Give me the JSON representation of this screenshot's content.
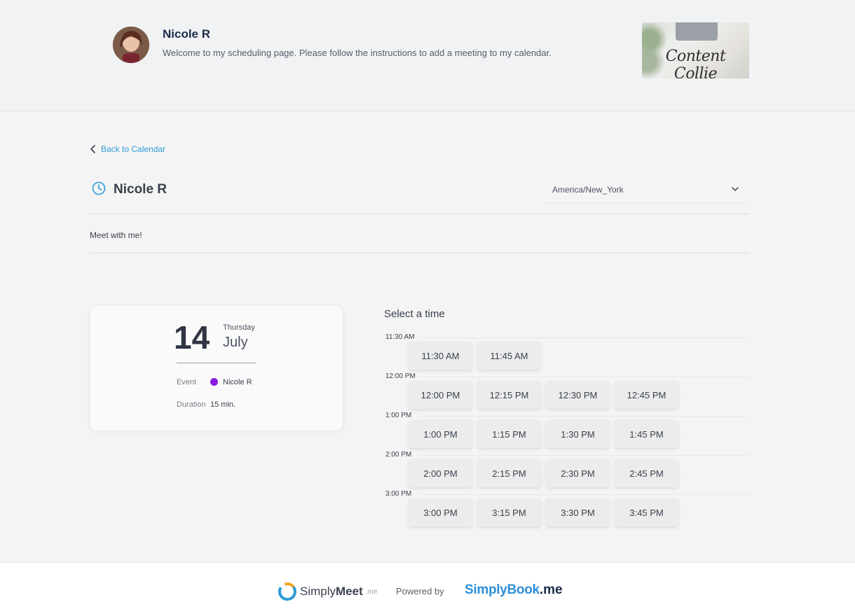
{
  "header": {
    "host_name": "Nicole R",
    "welcome_text": "Welcome to my scheduling page. Please follow the instructions to add a meeting to my calendar.",
    "logo_text": "Content Collie"
  },
  "nav": {
    "back_label": "Back to Calendar"
  },
  "booking": {
    "title": "Nicole R",
    "timezone": "America/New_York",
    "description": "Meet with me!"
  },
  "summary": {
    "day": "14",
    "weekday": "Thursday",
    "month": "July",
    "event_label": "Event",
    "event_value": "Nicole R",
    "duration_label": "Duration",
    "duration_value": "15 min.",
    "event_color": "#8a1be0"
  },
  "times": {
    "heading": "Select a time",
    "groups": [
      {
        "hour": "11:30 AM",
        "slots": [
          "11:30 AM",
          "11:45 AM"
        ]
      },
      {
        "hour": "12:00 PM",
        "slots": [
          "12:00 PM",
          "12:15 PM",
          "12:30 PM",
          "12:45 PM"
        ]
      },
      {
        "hour": "1:00 PM",
        "slots": [
          "1:00 PM",
          "1:15 PM",
          "1:30 PM",
          "1:45 PM"
        ]
      },
      {
        "hour": "2:00 PM",
        "slots": [
          "2:00 PM",
          "2:15 PM",
          "2:30 PM",
          "2:45 PM"
        ]
      },
      {
        "hour": "3:00 PM",
        "slots": [
          "3:00 PM",
          "3:15 PM",
          "3:30 PM",
          "3:45 PM"
        ]
      }
    ]
  },
  "footer": {
    "simplymeet_a": "Simply",
    "simplymeet_b": "Meet",
    "simplymeet_suffix": ".me",
    "powered_by": "Powered by",
    "simplybook_a": "SimplyBook",
    "simplybook_b": ".me"
  },
  "colors": {
    "accent": "#2e9bd6",
    "brand_blue": "#2e8fd8"
  }
}
